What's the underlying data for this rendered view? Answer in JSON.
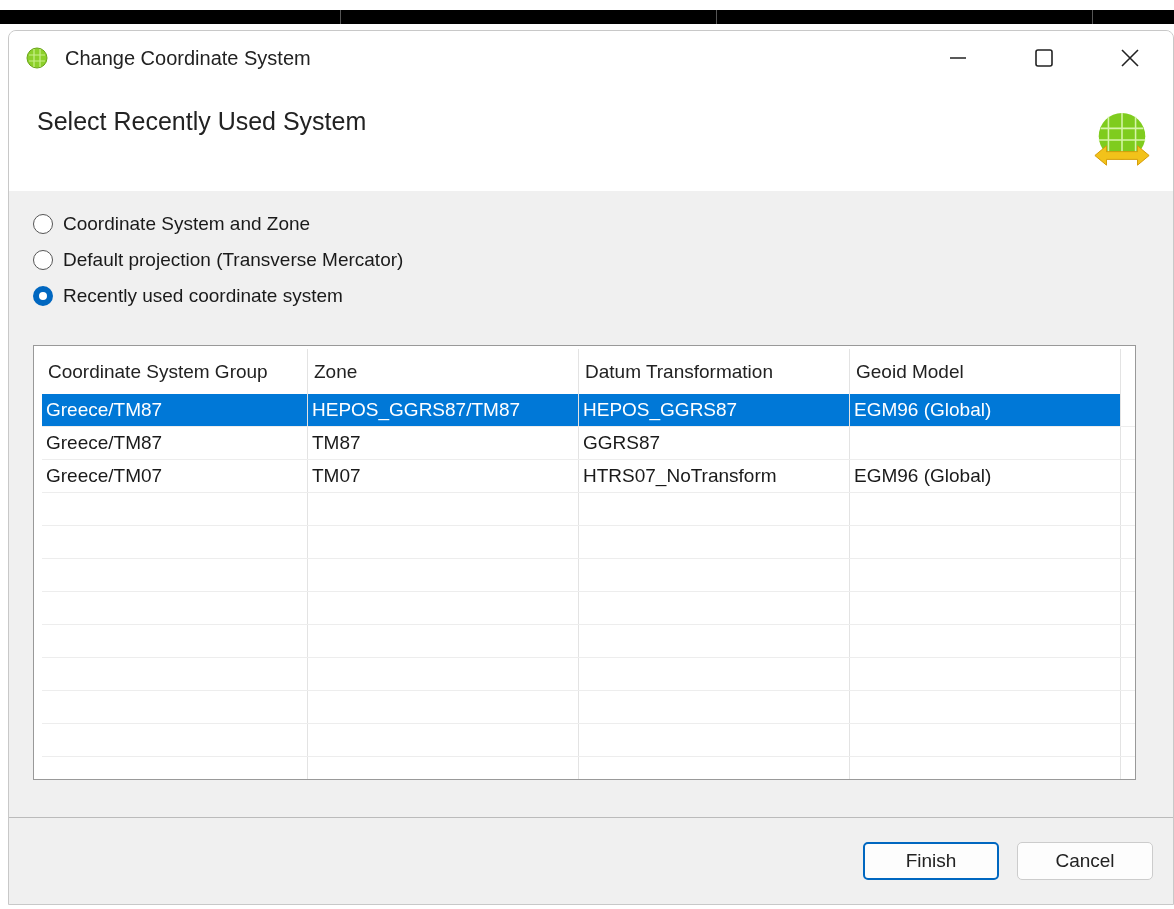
{
  "window": {
    "title": "Change Coordinate System",
    "controls": [
      {
        "kind": "minimize"
      },
      {
        "kind": "maximize"
      },
      {
        "kind": "close"
      }
    ]
  },
  "header": {
    "title": "Select Recently Used System"
  },
  "options": [
    {
      "label": "Coordinate System and Zone",
      "selected": false
    },
    {
      "label": "Default projection (Transverse Mercator)",
      "selected": false
    },
    {
      "label": "Recently used coordinate system",
      "selected": true
    }
  ],
  "table": {
    "columns": [
      "Coordinate System Group",
      "Zone",
      "Datum Transformation",
      "Geoid Model"
    ],
    "rows": [
      {
        "cells": [
          "Greece/TM87",
          "HEPOS_GGRS87/TM87",
          "HEPOS_GGRS87",
          "EGM96 (Global)"
        ],
        "selected": true
      },
      {
        "cells": [
          "Greece/TM87",
          "TM87",
          "GGRS87",
          ""
        ],
        "selected": false
      },
      {
        "cells": [
          "Greece/TM07",
          "TM07",
          "HTRS07_NoTransform",
          "EGM96 (Global)"
        ],
        "selected": false
      }
    ]
  },
  "buttons": [
    {
      "label": "Finish",
      "kind": "default"
    },
    {
      "label": "Cancel",
      "kind": "normal"
    }
  ]
}
